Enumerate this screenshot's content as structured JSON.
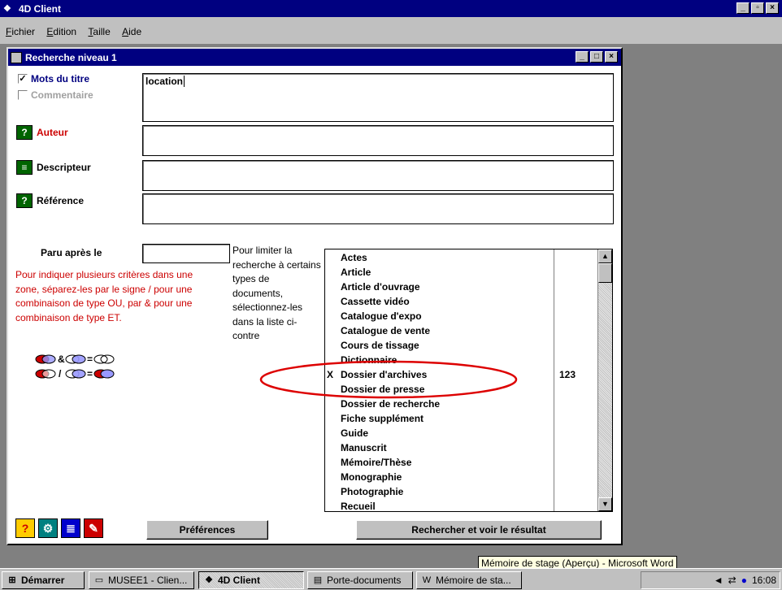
{
  "app": {
    "title": "4D Client"
  },
  "menu": [
    "Fichier",
    "Edition",
    "Taille",
    "Aide"
  ],
  "dialog": {
    "title": "Recherche niveau 1",
    "mots_du_titre": {
      "label": "Mots du titre",
      "checked": true,
      "value": "location"
    },
    "commentaire": {
      "label": "Commentaire",
      "checked": false
    },
    "auteur": {
      "label": "Auteur",
      "value": ""
    },
    "descripteur": {
      "label": "Descripteur",
      "value": ""
    },
    "reference": {
      "label": "Référence",
      "value": ""
    },
    "paru_apres": {
      "label": "Paru après le",
      "value": ""
    },
    "help_red": "Pour indiquer plusieurs critères dans une zone, séparez-les par le signe / pour une combinaison de type OU, par & pour une combinaison de type ET.",
    "help_types": "Pour limiter la recherche à certains types de documents, sélectionnez-les dans la liste ci-contre",
    "symbols": {
      "and": "&",
      "eq": "=",
      "or": "/"
    },
    "doc_types": [
      {
        "mark": "",
        "name": "Actes",
        "count": ""
      },
      {
        "mark": "",
        "name": "Article",
        "count": ""
      },
      {
        "mark": "",
        "name": "Article d'ouvrage",
        "count": ""
      },
      {
        "mark": "",
        "name": "Cassette vidéo",
        "count": ""
      },
      {
        "mark": "",
        "name": "Catalogue d'expo",
        "count": ""
      },
      {
        "mark": "",
        "name": "Catalogue de vente",
        "count": ""
      },
      {
        "mark": "",
        "name": "Cours de tissage",
        "count": ""
      },
      {
        "mark": "",
        "name": "Dictionnaire",
        "count": ""
      },
      {
        "mark": "X",
        "name": "Dossier d'archives",
        "count": "123"
      },
      {
        "mark": "",
        "name": "Dossier de presse",
        "count": ""
      },
      {
        "mark": "",
        "name": "Dossier de recherche",
        "count": ""
      },
      {
        "mark": "",
        "name": "Fiche supplément",
        "count": ""
      },
      {
        "mark": "",
        "name": "Guide",
        "count": ""
      },
      {
        "mark": "",
        "name": "Manuscrit",
        "count": ""
      },
      {
        "mark": "",
        "name": "Mémoire/Thèse",
        "count": ""
      },
      {
        "mark": "",
        "name": "Monographie",
        "count": ""
      },
      {
        "mark": "",
        "name": "Photographie",
        "count": ""
      },
      {
        "mark": "",
        "name": "Recueil",
        "count": ""
      }
    ],
    "buttons": {
      "preferences": "Préférences",
      "search": "Rechercher et voir le résultat"
    }
  },
  "taskbar": {
    "start": "Démarrer",
    "items": [
      "MUSEE1 - Clien...",
      "4D Client",
      "Porte-documents",
      "Mémoire de sta..."
    ],
    "clock": "16:08",
    "tooltip": "Mémoire de stage (Aperçu) - Microsoft Word"
  },
  "colors": {
    "title_bar": "#000080",
    "help_red": "#cc0000",
    "highlight_oval": "#dd0000"
  }
}
